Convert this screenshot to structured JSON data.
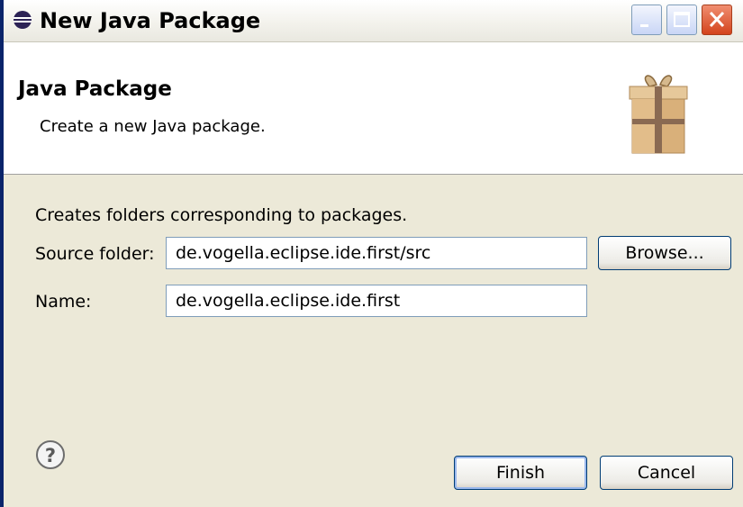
{
  "window": {
    "title": "New Java Package"
  },
  "banner": {
    "title": "Java Package",
    "description": "Create a new Java package."
  },
  "form": {
    "info": "Creates folders corresponding to packages.",
    "source_folder_label": "Source folder:",
    "source_folder_value": "de.vogella.eclipse.ide.first/src",
    "name_label": "Name:",
    "name_value": "de.vogella.eclipse.ide.first"
  },
  "buttons": {
    "browse": "Browse...",
    "finish": "Finish",
    "cancel": "Cancel"
  },
  "icons": {
    "app": "eclipse-icon",
    "banner": "package-icon",
    "help": "help-icon"
  },
  "colors": {
    "accent": "#0a246a",
    "close": "#d3431c"
  }
}
